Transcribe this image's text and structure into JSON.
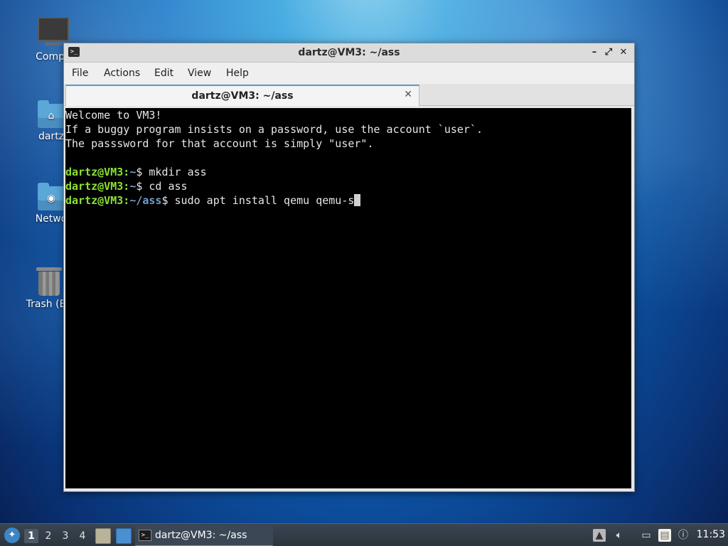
{
  "desktop": {
    "icons": [
      {
        "label": "Compu",
        "icon": "computer-icon"
      },
      {
        "label": "dartz",
        "icon": "home-folder-icon"
      },
      {
        "label": "Netwo",
        "icon": "network-folder-icon"
      },
      {
        "label": "Trash (En",
        "icon": "trash-icon"
      }
    ]
  },
  "window": {
    "title": "dartz@VM3: ~/ass",
    "app_icon": ">_",
    "controls": {
      "minimize": "–",
      "maximize": "⤢",
      "close": "✕"
    },
    "menu": [
      "File",
      "Actions",
      "Edit",
      "View",
      "Help"
    ],
    "tab": {
      "label": "dartz@VM3: ~/ass",
      "close": "✕"
    }
  },
  "terminal": {
    "motd": [
      "Welcome to VM3!",
      "If a buggy program insists on a password, use the account `user`.",
      "The passsword for that account is simply \"user\"."
    ],
    "commands": [
      {
        "user": "dartz@VM3",
        "sep": ":",
        "path": "~",
        "prompt": "$ ",
        "cmd": "mkdir ass"
      },
      {
        "user": "dartz@VM3",
        "sep": ":",
        "path": "~",
        "prompt": "$ ",
        "cmd": "cd ass"
      },
      {
        "user": "dartz@VM3",
        "sep": ":",
        "path": "~/ass",
        "prompt": "$ ",
        "cmd": "sudo apt install qemu qemu-s"
      }
    ],
    "colors": {
      "user": "#8ae234",
      "path": "#729fcf",
      "bg": "#000000",
      "fg": "#e6e6e6"
    }
  },
  "taskbar": {
    "start_icon": "lxqt-start-icon",
    "workspaces": [
      "1",
      "2",
      "3",
      "4"
    ],
    "active_workspace": "1",
    "task": {
      "label": "dartz@VM3: ~/ass",
      "icon": ">_"
    },
    "clock": "11:53"
  }
}
